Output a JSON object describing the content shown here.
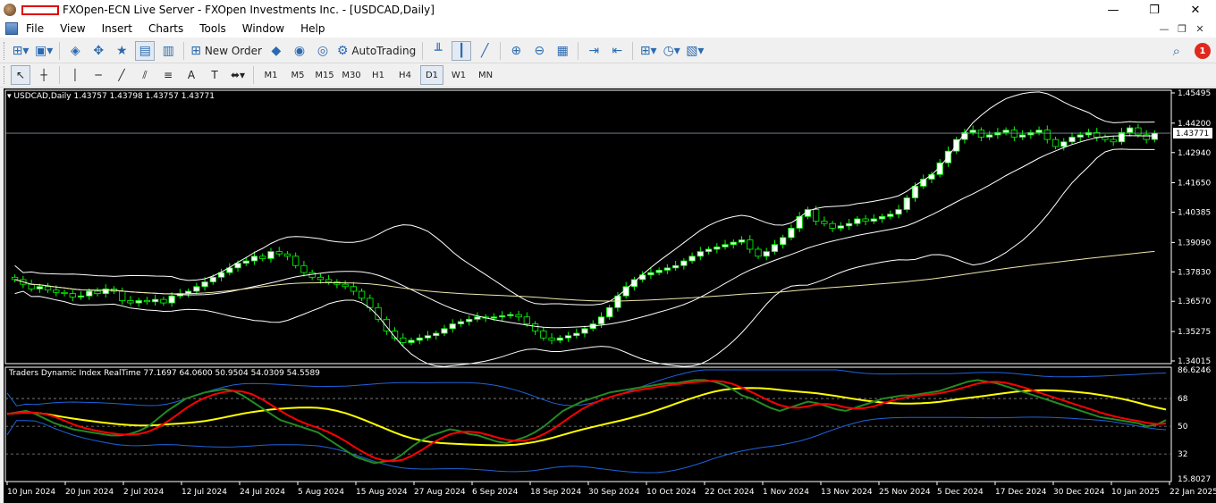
{
  "window": {
    "title": "FXOpen-ECN Live Server - FXOpen Investments Inc. - [USDCAD,Daily]",
    "controls": [
      "—",
      "❐",
      "✕"
    ]
  },
  "menu": {
    "items": [
      "File",
      "View",
      "Insert",
      "Charts",
      "Tools",
      "Window",
      "Help"
    ]
  },
  "toolbar": {
    "new_order_label": "New Order",
    "autotrading_label": "AutoTrading",
    "alert_count": "1"
  },
  "timeframes": [
    "M1",
    "M5",
    "M15",
    "M30",
    "H1",
    "H4",
    "D1",
    "W1",
    "MN"
  ],
  "active_timeframe": "D1",
  "chart": {
    "symbol_info": "USDCAD,Daily  1.43757 1.43798 1.43757 1.43771",
    "current_price": "1.43771",
    "price_ticks": [
      "1.45495",
      "1.44200",
      "1.42940",
      "1.41650",
      "1.40385",
      "1.39090",
      "1.37830",
      "1.36570",
      "1.35275",
      "1.34015"
    ],
    "date_ticks": [
      "10 Jun 2024",
      "20 Jun 2024",
      "2 Jul 2024",
      "12 Jul 2024",
      "24 Jul 2024",
      "5 Aug 2024",
      "15 Aug 2024",
      "27 Aug 2024",
      "6 Sep 2024",
      "18 Sep 2024",
      "30 Sep 2024",
      "10 Oct 2024",
      "22 Oct 2024",
      "1 Nov 2024",
      "13 Nov 2024",
      "25 Nov 2024",
      "5 Dec 2024",
      "17 Dec 2024",
      "30 Dec 2024",
      "10 Jan 2025",
      "22 Jan 2025"
    ]
  },
  "indicator": {
    "label": "Traders Dynamic Index RealTime 77.1697 64.0600 50.9504 54.0309 54.5589",
    "ticks": [
      "86.6246",
      "68",
      "50",
      "32",
      "15.8027"
    ]
  },
  "colors": {
    "bull_candle": "#ffffff",
    "bear_candle": "#000000",
    "candle_outline": "#00ff00",
    "bands": "#ffffff",
    "ma_long": "#eee8aa",
    "tdi_green": "#228b22",
    "tdi_red": "#ff0000",
    "tdi_yellow": "#ffff00",
    "tdi_blue": "#1e64dc"
  },
  "chart_data": {
    "type": "candlestick",
    "title": "USDCAD,Daily",
    "ylim": [
      1.34015,
      1.45495
    ],
    "price_series": [
      1.375,
      1.373,
      1.371,
      1.372,
      1.3705,
      1.3695,
      1.369,
      1.3675,
      1.368,
      1.37,
      1.369,
      1.371,
      1.37,
      1.366,
      1.365,
      1.366,
      1.3655,
      1.3665,
      1.365,
      1.368,
      1.369,
      1.37,
      1.372,
      1.374,
      1.376,
      1.378,
      1.38,
      1.382,
      1.383,
      1.385,
      1.384,
      1.387,
      1.386,
      1.385,
      1.381,
      1.378,
      1.376,
      1.375,
      1.374,
      1.373,
      1.372,
      1.37,
      1.367,
      1.363,
      1.358,
      1.353,
      1.35,
      1.348,
      1.349,
      1.35,
      1.351,
      1.352,
      1.354,
      1.356,
      1.357,
      1.358,
      1.359,
      1.3585,
      1.359,
      1.3595,
      1.36,
      1.359,
      1.356,
      1.353,
      1.35,
      1.349,
      1.35,
      1.351,
      1.352,
      1.354,
      1.356,
      1.359,
      1.363,
      1.368,
      1.372,
      1.375,
      1.377,
      1.378,
      1.379,
      1.38,
      1.381,
      1.383,
      1.385,
      1.387,
      1.388,
      1.389,
      1.39,
      1.391,
      1.392,
      1.388,
      1.385,
      1.387,
      1.39,
      1.393,
      1.397,
      1.402,
      1.405,
      1.4,
      1.399,
      1.397,
      1.398,
      1.399,
      1.401,
      1.4,
      1.401,
      1.402,
      1.403,
      1.405,
      1.41,
      1.415,
      1.418,
      1.42,
      1.425,
      1.43,
      1.435,
      1.438,
      1.439,
      1.436,
      1.437,
      1.438,
      1.439,
      1.436,
      1.437,
      1.438,
      1.439,
      1.435,
      1.432,
      1.434,
      1.436,
      1.437,
      1.438,
      1.436,
      1.435,
      1.434,
      1.438,
      1.44,
      1.437,
      1.435,
      1.4377
    ],
    "tdi_ylim": [
      15.8027,
      86.6246
    ],
    "tdi_levels": [
      68,
      50,
      32
    ],
    "tdi_rsi": [
      58,
      59,
      60,
      58,
      55,
      52,
      50,
      48,
      47,
      46,
      45,
      44,
      44,
      45,
      47,
      50,
      55,
      60,
      64,
      68,
      70,
      72,
      73,
      74,
      73,
      70,
      66,
      62,
      58,
      54,
      52,
      50,
      48,
      46,
      42,
      38,
      34,
      30,
      28,
      26,
      27,
      28,
      32,
      37,
      41,
      44,
      46,
      48,
      47,
      45,
      44,
      42,
      40,
      39,
      41,
      43,
      46,
      50,
      55,
      60,
      63,
      66,
      68,
      70,
      72,
      73,
      74,
      75,
      76,
      77,
      78,
      78,
      79,
      80,
      80,
      79,
      77,
      74,
      70,
      68,
      65,
      62,
      60,
      62,
      64,
      66,
      65,
      63,
      61,
      60,
      62,
      64,
      66,
      68,
      69,
      70,
      70,
      71,
      72,
      73,
      75,
      77,
      79,
      80,
      79,
      78,
      76,
      74,
      72,
      70,
      68,
      66,
      64,
      62,
      60,
      58,
      56,
      55,
      54,
      53,
      52,
      50,
      51,
      54
    ]
  }
}
